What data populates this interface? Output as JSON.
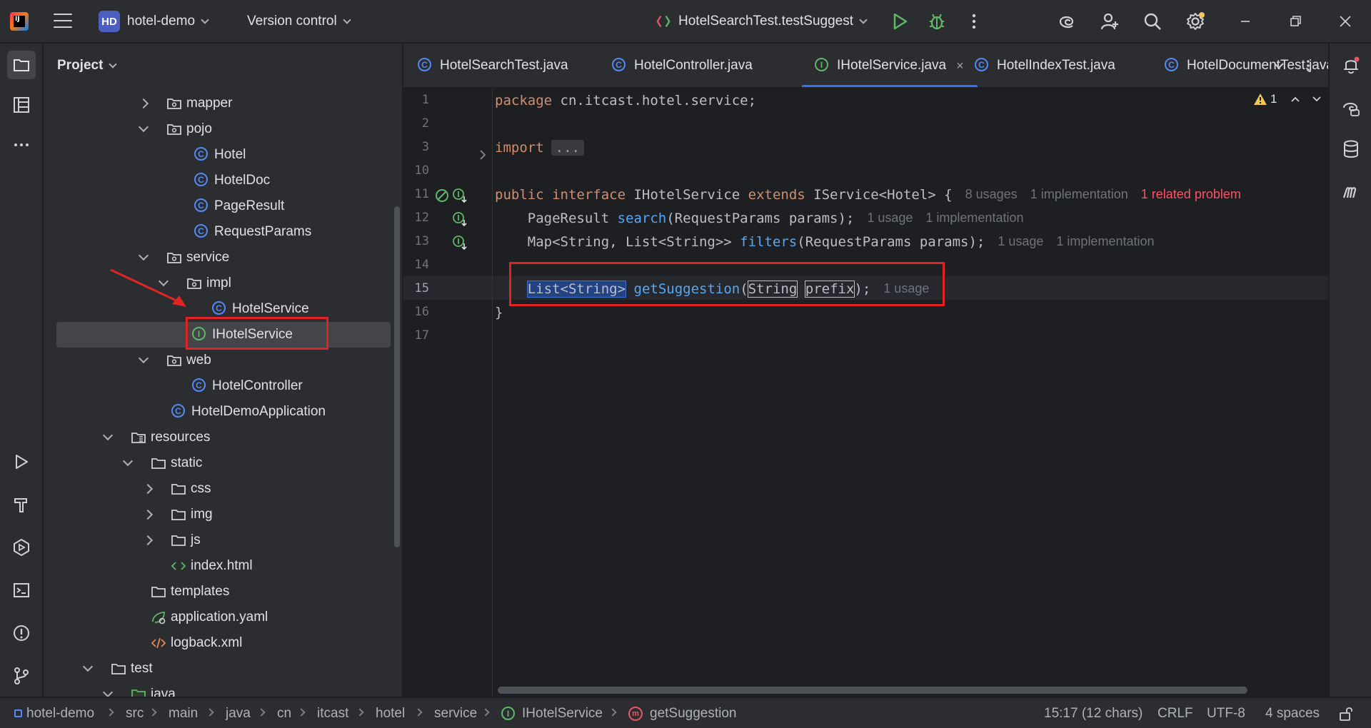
{
  "titlebar": {
    "project_badge": "HD",
    "project_name": "hotel-demo",
    "vcs_label": "Version control",
    "run_config": "HotelSearchTest.testSuggest"
  },
  "project_panel": {
    "title": "Project",
    "tree": [
      {
        "label": "mapper",
        "kind": "folder",
        "expanded": false
      },
      {
        "label": "pojo",
        "kind": "folder",
        "expanded": true
      },
      {
        "label": "Hotel",
        "kind": "class"
      },
      {
        "label": "HotelDoc",
        "kind": "class"
      },
      {
        "label": "PageResult",
        "kind": "class"
      },
      {
        "label": "RequestParams",
        "kind": "class"
      },
      {
        "label": "service",
        "kind": "folder",
        "expanded": true
      },
      {
        "label": "impl",
        "kind": "folder",
        "expanded": true
      },
      {
        "label": "HotelService",
        "kind": "class"
      },
      {
        "label": "IHotelService",
        "kind": "interface",
        "selected": true
      },
      {
        "label": "web",
        "kind": "folder",
        "expanded": true
      },
      {
        "label": "HotelController",
        "kind": "class"
      },
      {
        "label": "HotelDemoApplication",
        "kind": "spring-class"
      },
      {
        "label": "resources",
        "kind": "res-folder",
        "expanded": true
      },
      {
        "label": "static",
        "kind": "plain-folder",
        "expanded": true
      },
      {
        "label": "css",
        "kind": "plain-folder",
        "expanded": false
      },
      {
        "label": "img",
        "kind": "plain-folder",
        "expanded": false
      },
      {
        "label": "js",
        "kind": "plain-folder",
        "expanded": false
      },
      {
        "label": "index.html",
        "kind": "html"
      },
      {
        "label": "templates",
        "kind": "plain-folder"
      },
      {
        "label": "application.yaml",
        "kind": "yaml"
      },
      {
        "label": "logback.xml",
        "kind": "xml"
      },
      {
        "label": "test",
        "kind": "plain-folder",
        "expanded": true
      },
      {
        "label": "java",
        "kind": "test-folder",
        "expanded": true
      }
    ]
  },
  "tabs": [
    {
      "label": "HotelSearchTest.java",
      "kind": "class"
    },
    {
      "label": "HotelController.java",
      "kind": "class"
    },
    {
      "label": "IHotelService.java",
      "kind": "interface",
      "active": true,
      "close": "×"
    },
    {
      "label": "HotelIndexTest.java",
      "kind": "class"
    },
    {
      "label": "HotelDocumentTest.java",
      "kind": "class"
    }
  ],
  "editor": {
    "line_numbers": [
      "1",
      "2",
      "3",
      "10",
      "11",
      "12",
      "13",
      "14",
      "15",
      "16",
      "17"
    ],
    "warning_count": "1",
    "line1": {
      "kw": "package",
      "rest": " cn.itcast.hotel.service;"
    },
    "line3": {
      "kw": "import",
      "fold": "..."
    },
    "line11": {
      "kw1": "public",
      "kw2": "interface",
      "name": " IHotelService ",
      "kw3": "extends",
      "rest": " IService<Hotel> {",
      "hint_usages": "8 usages",
      "hint_impl": "1 implementation",
      "hint_problem": "1 related problem"
    },
    "line12": {
      "type": "    PageResult ",
      "fn": "search",
      "rest": "(RequestParams params);",
      "hint_usages": "1 usage",
      "hint_impl": "1 implementation"
    },
    "line13": {
      "type": "    Map<String, List<String>> ",
      "fn": "filters",
      "rest": "(RequestParams params);",
      "hint_usages": "1 usage",
      "hint_impl": "1 implementation"
    },
    "line15": {
      "indent": "    ",
      "type": "List<String>",
      "space": " ",
      "fn": "getSuggestion",
      "open": "(",
      "ptype": "String",
      "pspace": " ",
      "pname": "prefix",
      "close": ");",
      "hint_usages": "1 usage"
    },
    "line16": {
      "text": "}"
    }
  },
  "statusbar": {
    "breadcrumbs": [
      "hotel-demo",
      "src",
      "main",
      "java",
      "cn",
      "itcast",
      "hotel",
      "service",
      "IHotelService",
      "getSuggestion"
    ],
    "position": "15:17 (12 chars)",
    "line_sep": "CRLF",
    "encoding": "UTF-8",
    "indent": "4 spaces"
  },
  "colors": {
    "accent": "#3574f0",
    "annotation_red": "#e02424",
    "keyword": "#cf8e6d",
    "function": "#56a8f5",
    "error": "#f75464"
  }
}
